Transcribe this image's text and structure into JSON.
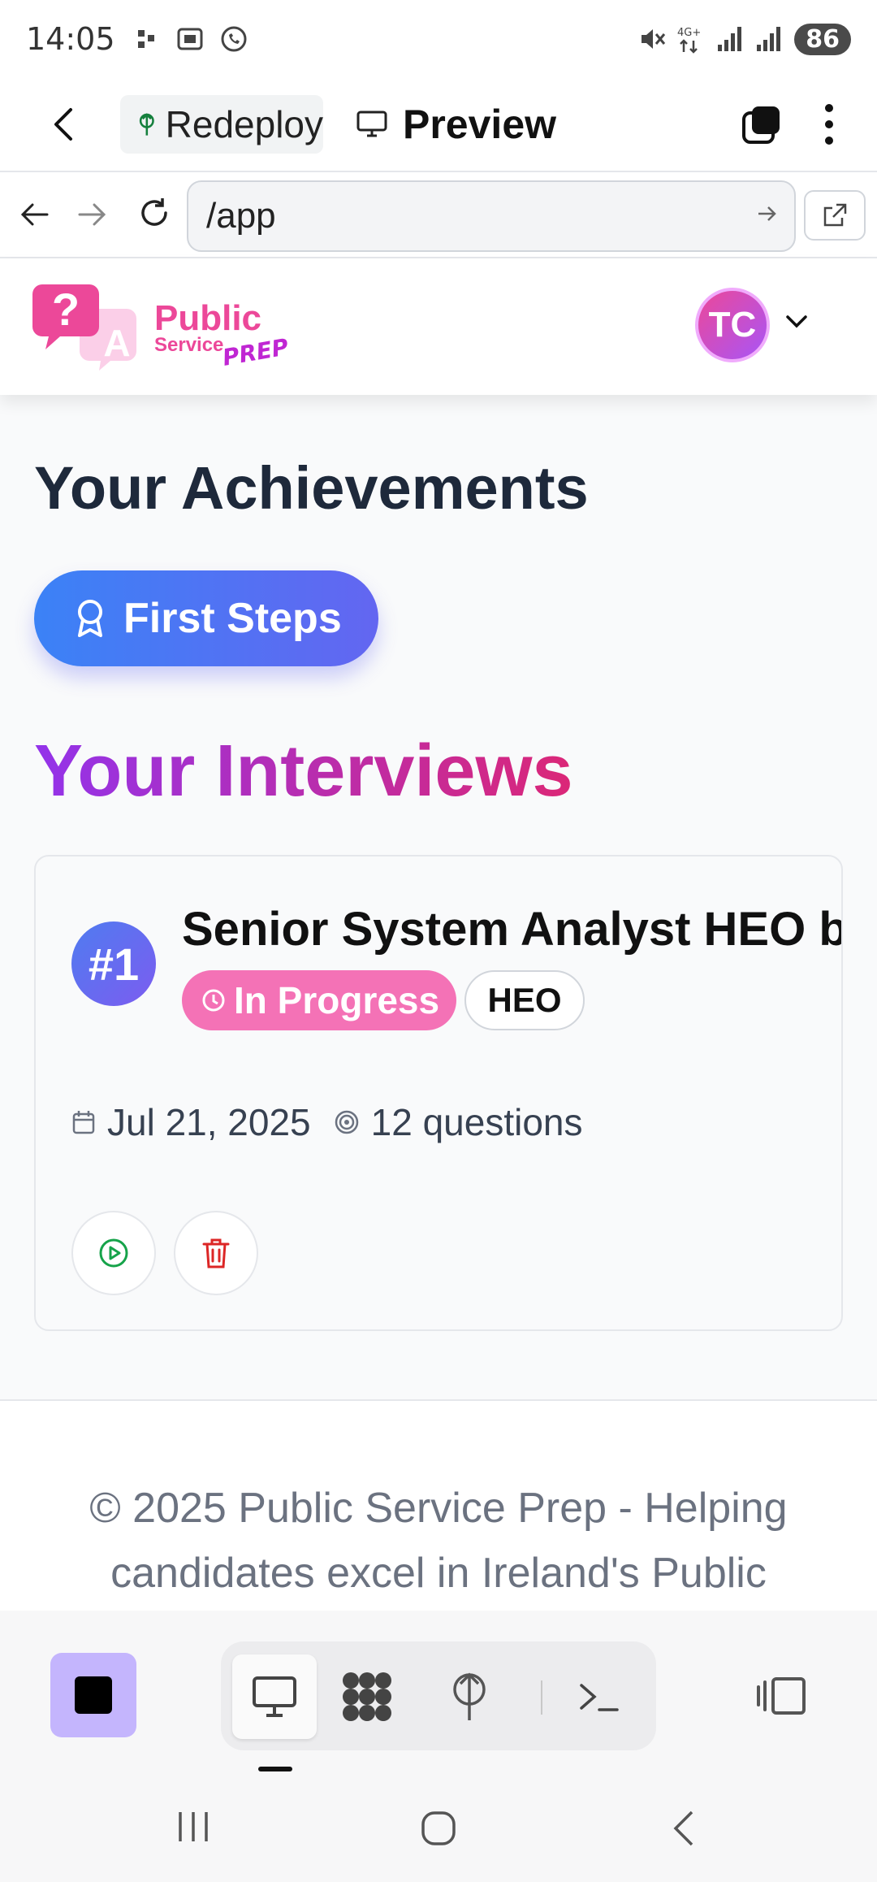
{
  "status_bar": {
    "time": "14:05",
    "battery": "86",
    "icons": [
      "notification-icon",
      "screenshot-icon",
      "whatsapp-icon",
      "mute-icon",
      "4g-icon",
      "signal-icon",
      "signal-icon"
    ]
  },
  "browser": {
    "tab_label": "Redeploy",
    "preview_label": "Preview",
    "url": "/app"
  },
  "header": {
    "logo_line1": "Public",
    "logo_line2": "Service",
    "logo_line3": "PREP",
    "logo_q": "?",
    "logo_a": "A",
    "avatar_initials": "TC"
  },
  "achievements": {
    "heading": "Your Achievements",
    "badges": [
      {
        "label": "First Steps",
        "icon": "award-icon"
      }
    ]
  },
  "interviews": {
    "heading": "Your Interviews",
    "items": [
      {
        "number": "#1",
        "title": "Senior System Analyst HEO b",
        "status": "In Progress",
        "grade": "HEO",
        "date": "Jul 21, 2025",
        "questions": "12 questions"
      }
    ]
  },
  "footer": {
    "text": "© 2025 Public Service Prep - Helping candidates excel in Ireland's Public"
  },
  "colors": {
    "accent_blue": "#3b82f6",
    "accent_indigo": "#6366f1",
    "heading_purple": "#9333ea",
    "heading_pink": "#db2777",
    "status_pink": "#f472b6",
    "play_green": "#16a34a",
    "delete_red": "#dc2626",
    "stop_purple": "#c4b5fd"
  }
}
